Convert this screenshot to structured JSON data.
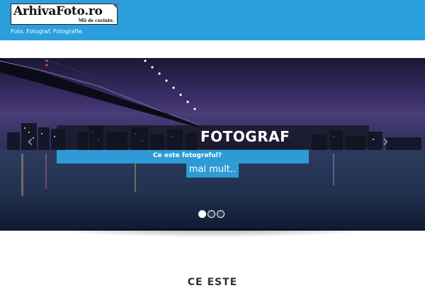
{
  "header": {
    "logo_text": "ArhivaFoto.ro",
    "logo_subtext": "Mii de cuvinte.",
    "tagline": "Foto. Fotograf. Fotografie.",
    "bg_color": "#2b9fdc"
  },
  "slider": {
    "title": "FOTOGRAF",
    "subtitle": "Ce este fotograful?",
    "button_label": "mai mult..",
    "prev_icon": "chevron-left-icon",
    "next_icon": "chevron-right-icon",
    "slide_count": 3,
    "active_slide": 1,
    "accent_color": "#2e9bd6"
  },
  "section": {
    "title": "CE ESTE"
  }
}
